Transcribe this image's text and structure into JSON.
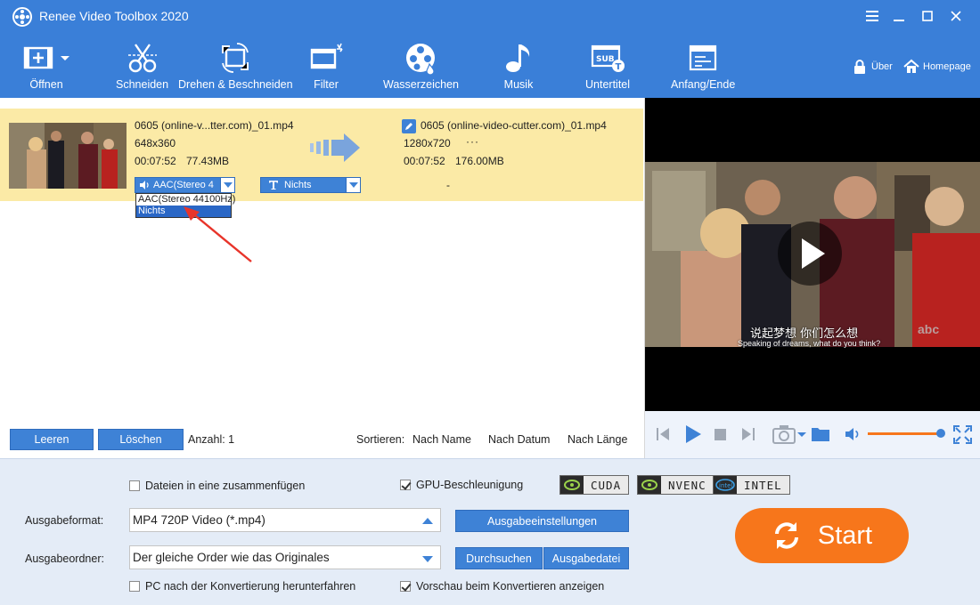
{
  "window": {
    "title": "Renee Video Toolbox 2020",
    "controls": [
      "menu-icon",
      "minimize-icon",
      "maximize-icon",
      "close-icon"
    ]
  },
  "toolbar": {
    "items": [
      {
        "label": "Öffnen",
        "icon": "open-file-icon"
      },
      {
        "label": "Schneiden",
        "icon": "scissors-icon"
      },
      {
        "label": "Drehen & Beschneiden",
        "icon": "rotate-crop-icon"
      },
      {
        "label": "Filter",
        "icon": "filter-icon"
      },
      {
        "label": "Wasserzeichen",
        "icon": "watermark-icon"
      },
      {
        "label": "Musik",
        "icon": "music-icon"
      },
      {
        "label": "Untertitel",
        "icon": "subtitle-icon"
      },
      {
        "label": "Anfang/Ende",
        "icon": "intro-outro-icon"
      }
    ],
    "about": "Über",
    "homepage": "Homepage"
  },
  "file": {
    "source": {
      "name": "0605 (online-v...tter.com)_01.mp4",
      "resolution": "648x360",
      "duration": "00:07:52",
      "size": "77.43MB"
    },
    "output": {
      "name": "0605 (online-video-cutter.com)_01.mp4",
      "resolution": "1280x720",
      "more": "···",
      "duration": "00:07:52",
      "size": "176.00MB"
    },
    "audio_dropdown": "AAC(Stereo 4",
    "subtitle_dropdown": "Nichts",
    "dash": "-",
    "audio_options": [
      "AAC(Stereo 44100Hz)",
      "Nichts"
    ]
  },
  "listbar": {
    "clear": "Leeren",
    "delete": "Löschen",
    "count": "Anzahl: 1",
    "sort_label": "Sortieren:",
    "sort_name": "Nach Name",
    "sort_date": "Nach Datum",
    "sort_length": "Nach Länge"
  },
  "preview": {
    "subtitle_cn": "说起梦想 你们怎么想",
    "subtitle_en": "Speaking of dreams, what do you think?",
    "watermark": "abc",
    "volume": 0.9
  },
  "settings": {
    "merge": "Dateien in eine zusammenfügen",
    "merge_checked": false,
    "gpu": "GPU-Beschleunigung",
    "gpu_checked": true,
    "badges": [
      "CUDA",
      "NVENC",
      "INTEL"
    ],
    "format_label": "Ausgabeformat:",
    "format_value": "MP4 720P Video (*.mp4)",
    "format_settings": "Ausgabeeinstellungen",
    "folder_label": "Ausgabeordner:",
    "folder_value": "Der gleiche Order wie das Originales",
    "browse": "Durchsuchen",
    "open_output": "Ausgabedatei",
    "shutdown": "PC nach der Konvertierung herunterfahren",
    "shutdown_checked": false,
    "preview_convert": "Vorschau beim Konvertieren anzeigen",
    "preview_checked": true,
    "start": "Start"
  },
  "colors": {
    "accent": "#3a7fd8",
    "row_highlight": "#fbeaa6",
    "start": "#f7761b",
    "settings_bg": "#e4ecf7"
  }
}
